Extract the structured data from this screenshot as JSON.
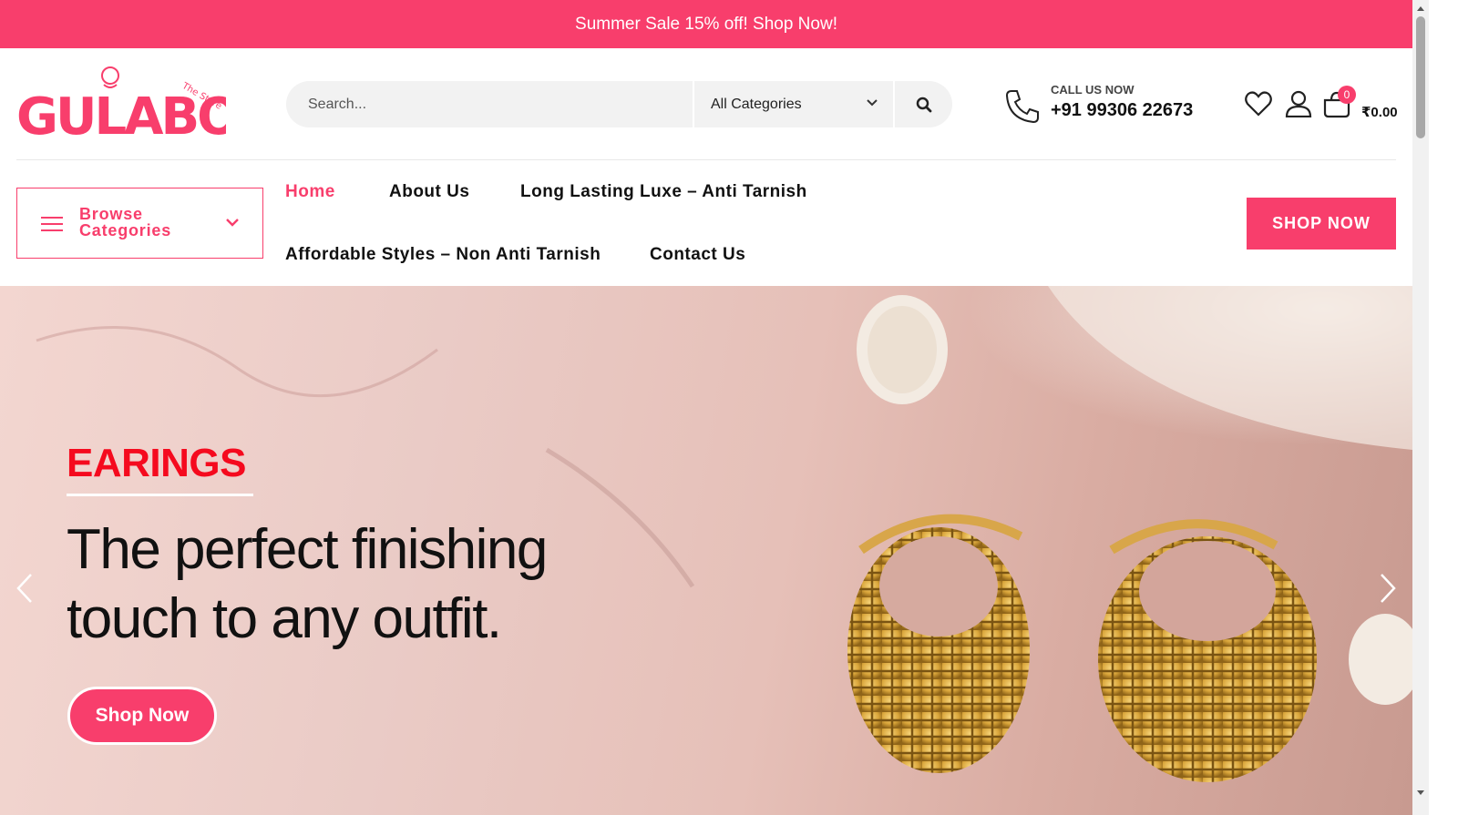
{
  "announcement": "Summer Sale 15% off! Shop Now!",
  "logo": {
    "text": "GULABO",
    "tagline": "The Store"
  },
  "search": {
    "placeholder": "Search...",
    "category": "All Categories"
  },
  "contact": {
    "label": "CALL US NOW",
    "phone": "+91 99306 22673"
  },
  "cart": {
    "count": "0",
    "total": "₹0.00"
  },
  "browse": {
    "label": "Browse Categories"
  },
  "nav": {
    "home": "Home",
    "about": "About Us",
    "luxe": "Long Lasting Luxe – Anti Tarnish",
    "affordable": "Affordable Styles – Non Anti Tarnish",
    "contact": "Contact Us"
  },
  "shop_now_button": "SHOP NOW",
  "hero": {
    "tag": "EARINGS",
    "headline": "The perfect finishing touch to any outfit.",
    "cta": "Shop Now"
  },
  "icons": {
    "phone": "phone-icon",
    "wishlist": "heart-icon",
    "account": "user-icon",
    "cart": "bag-icon",
    "search": "search-icon",
    "menu": "hamburger-icon",
    "prev": "chevron-left-icon",
    "next": "chevron-right-icon"
  },
  "colors": {
    "brand": "#f83e6c",
    "tag": "#f50a1e"
  }
}
